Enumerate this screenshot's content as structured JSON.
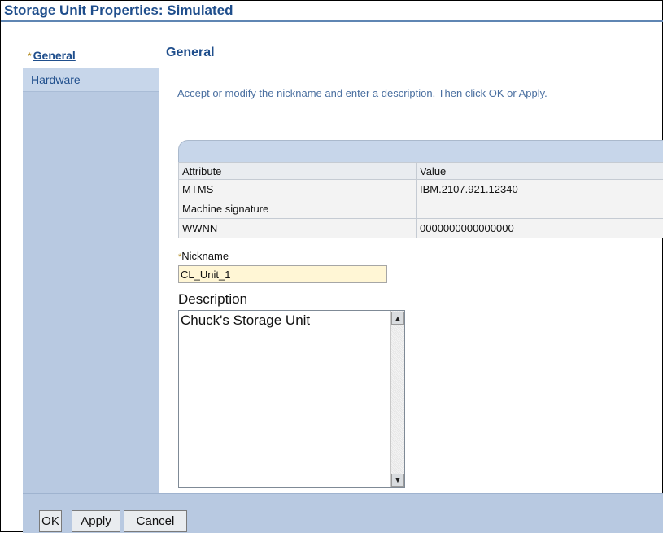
{
  "window": {
    "title": "Storage Unit Properties: Simulated"
  },
  "nav": {
    "items": [
      {
        "label": "General",
        "required_marker": "*",
        "selected": true
      },
      {
        "label": "Hardware",
        "selected": false
      }
    ]
  },
  "section": {
    "title": "General",
    "instructions": "Accept or modify the nickname and enter a description. Then click OK or Apply."
  },
  "table": {
    "headers": [
      "Attribute",
      "Value"
    ],
    "rows": [
      [
        "MTMS",
        "IBM.2107.921.12340"
      ],
      [
        "Machine signature",
        ""
      ],
      [
        "WWNN",
        "0000000000000000"
      ]
    ]
  },
  "nickname": {
    "required_marker": "*",
    "label": "Nickname",
    "value": "CL_Unit_1"
  },
  "description": {
    "label": "Description",
    "value": "Chuck's Storage Unit"
  },
  "buttons": {
    "ok": "OK",
    "apply": "Apply",
    "cancel": "Cancel"
  },
  "icons": {
    "scroll_up": "▲",
    "scroll_down": "▼"
  },
  "colors": {
    "accent": "#1f4e8c",
    "panel": "#b8c9e1",
    "required": "#b28a1e",
    "input_bg": "#fff6d5"
  }
}
